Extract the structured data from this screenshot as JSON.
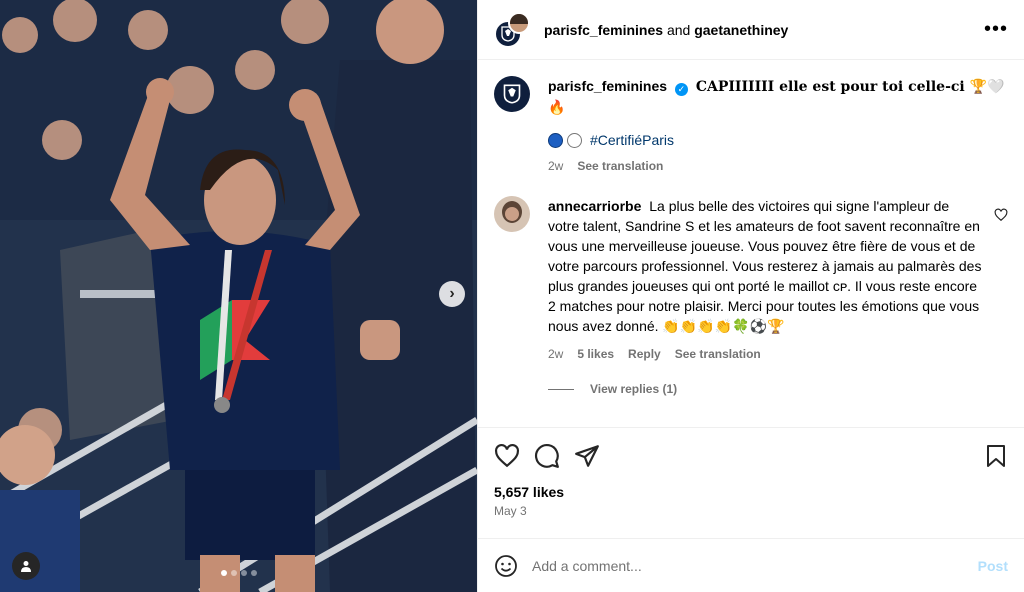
{
  "header": {
    "username": "parisfc_feminines",
    "connector": "and",
    "collaborator": "gaetanethiney",
    "more_label": "•••"
  },
  "caption": {
    "username": "parisfc_feminines",
    "text": "CAPIIIIIII elle est pour toi celle-ci 🏆🤍🔥",
    "hashtag": "#CertifiéParis",
    "time": "2w",
    "see_translation": "See translation"
  },
  "comment": {
    "username": "annecarriorbe",
    "text": "La plus belle des victoires qui signe l'ampleur de votre talent, Sandrine S et les amateurs de foot savent reconnaître en vous une merveilleuse joueuse. Vous pouvez être fière de vous et de votre parcours professionnel. Vous resterez à jamais au palmarès des plus grandes joueuses qui ont porté le maillot ᴄᴘ. Il vous reste encore 2 matches pour notre plaisir. Merci pour toutes les émotions que vous nous avez donné. 👏👏👏👏🍀⚽🏆",
    "time": "2w",
    "likes": "5 likes",
    "reply": "Reply",
    "see_translation": "See translation",
    "view_replies": "View replies (1)"
  },
  "post": {
    "likes": "5,657 likes",
    "date": "May 3"
  },
  "add_comment": {
    "placeholder": "Add a comment...",
    "post_label": "Post"
  },
  "carousel": {
    "slide_count": 4,
    "active_index": 0
  },
  "colors": {
    "verified": "#0095f6",
    "hashtag": "#00376b",
    "post_disabled": "#b2dffc",
    "club_navy": "#0f1f3d"
  },
  "icons": [
    "heart-icon",
    "comment-icon",
    "share-icon",
    "bookmark-icon",
    "emoji-icon",
    "more-icon",
    "chevron-right-icon",
    "user-tag-icon",
    "verified-icon"
  ]
}
